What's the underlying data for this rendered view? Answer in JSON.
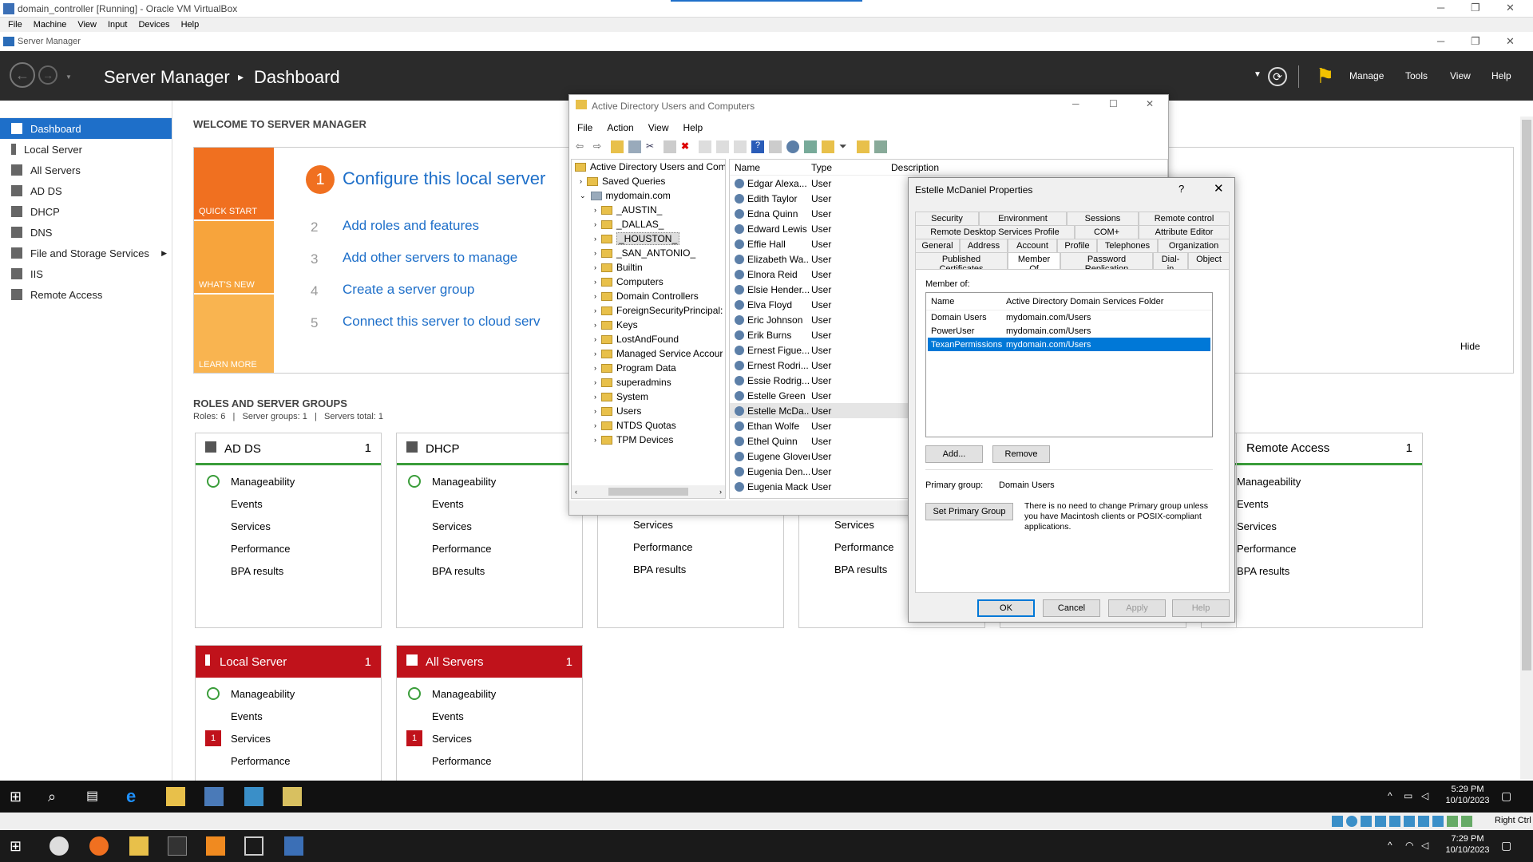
{
  "vbox": {
    "title": "domain_controller [Running] - Oracle VM VirtualBox",
    "menu": [
      "File",
      "Machine",
      "View",
      "Input",
      "Devices",
      "Help"
    ],
    "host_key": "Right Ctrl"
  },
  "sm": {
    "window_title": "Server Manager",
    "breadcrumb_root": "Server Manager",
    "breadcrumb_page": "Dashboard",
    "header_menu": [
      "Manage",
      "Tools",
      "View",
      "Help"
    ],
    "sidebar": [
      "Dashboard",
      "Local Server",
      "All Servers",
      "AD DS",
      "DHCP",
      "DNS",
      "File and Storage Services",
      "IIS",
      "Remote Access"
    ],
    "welcome": "WELCOME TO SERVER MANAGER",
    "quick_start": "QUICK START",
    "whats_new": "WHAT'S NEW",
    "learn_more": "LEARN MORE",
    "steps": [
      {
        "n": "1",
        "t": "Configure this local server"
      },
      {
        "n": "2",
        "t": "Add roles and features"
      },
      {
        "n": "3",
        "t": "Add other servers to manage"
      },
      {
        "n": "4",
        "t": "Create a server group"
      },
      {
        "n": "5",
        "t": "Connect this server to cloud serv"
      }
    ],
    "hide": "Hide",
    "roles_title": "ROLES AND SERVER GROUPS",
    "roles_summary": "Roles: 6   |   Server groups: 1   |   Servers total: 1",
    "tile_rows": [
      "Manageability",
      "Events",
      "Services",
      "Performance",
      "BPA results"
    ],
    "tiles": [
      {
        "name": "AD DS",
        "count": "1"
      },
      {
        "name": "DHCP",
        "count": ""
      },
      {
        "name": "Remote Access",
        "count": "1"
      },
      {
        "name": "Local Server",
        "count": "1"
      },
      {
        "name": "All Servers",
        "count": "1"
      }
    ],
    "badge": "1"
  },
  "aduc": {
    "title": "Active Directory Users and Computers",
    "menu": [
      "File",
      "Action",
      "View",
      "Help"
    ],
    "tree": [
      "Active Directory Users and Com",
      "Saved Queries",
      "mydomain.com",
      "_AUSTIN_",
      "_DALLAS_",
      "_HOUSTON_",
      "_SAN_ANTONIO_",
      "Builtin",
      "Computers",
      "Domain Controllers",
      "ForeignSecurityPrincipal:",
      "Keys",
      "LostAndFound",
      "Managed Service Accour",
      "Program Data",
      "superadmins",
      "System",
      "Users",
      "NTDS Quotas",
      "TPM Devices"
    ],
    "cols": [
      "Name",
      "Type",
      "Description"
    ],
    "users": [
      "Edgar Alexa...",
      "Edith Taylor",
      "Edna Quinn",
      "Edward Lewis",
      "Effie Hall",
      "Elizabeth Wa...",
      "Elnora Reid",
      "Elsie Hender...",
      "Elva Floyd",
      "Eric Johnson",
      "Erik Burns",
      "Ernest Figue...",
      "Ernest Rodri...",
      "Essie Rodrig...",
      "Estelle Green",
      "Estelle McDa...",
      "Ethan Wolfe",
      "Ethel Quinn",
      "Eugene Glover",
      "Eugenia Den...",
      "Eugenia Mack"
    ],
    "type": "User"
  },
  "props": {
    "title": "Estelle McDaniel Properties",
    "help": "?",
    "tabs1": [
      "Security",
      "Environment",
      "Sessions",
      "Remote control"
    ],
    "tabs2": [
      "Remote Desktop Services Profile",
      "COM+",
      "Attribute Editor"
    ],
    "tabs3": [
      "General",
      "Address",
      "Account",
      "Profile",
      "Telephones",
      "Organization"
    ],
    "tabs4": [
      "Published Certificates",
      "Member Of",
      "Password Replication",
      "Dial-in",
      "Object"
    ],
    "member_of": "Member of:",
    "col_name": "Name",
    "col_folder": "Active Directory Domain Services Folder",
    "rows": [
      {
        "n": "Domain Users",
        "f": "mydomain.com/Users"
      },
      {
        "n": "PowerUser",
        "f": "mydomain.com/Users"
      },
      {
        "n": "TexanPermissions",
        "f": "mydomain.com/Users"
      }
    ],
    "add": "Add...",
    "remove": "Remove",
    "primary_label": "Primary group:",
    "primary_value": "Domain Users",
    "set_primary": "Set Primary Group",
    "note": "There is no need to change Primary group unless you have Macintosh clients or POSIX-compliant applications.",
    "ok": "OK",
    "cancel": "Cancel",
    "apply": "Apply",
    "helpbtn": "Help"
  },
  "guest_clock": {
    "time": "5:29 PM",
    "date": "10/10/2023"
  },
  "host_clock": {
    "time": "7:29 PM",
    "date": "10/10/2023"
  }
}
